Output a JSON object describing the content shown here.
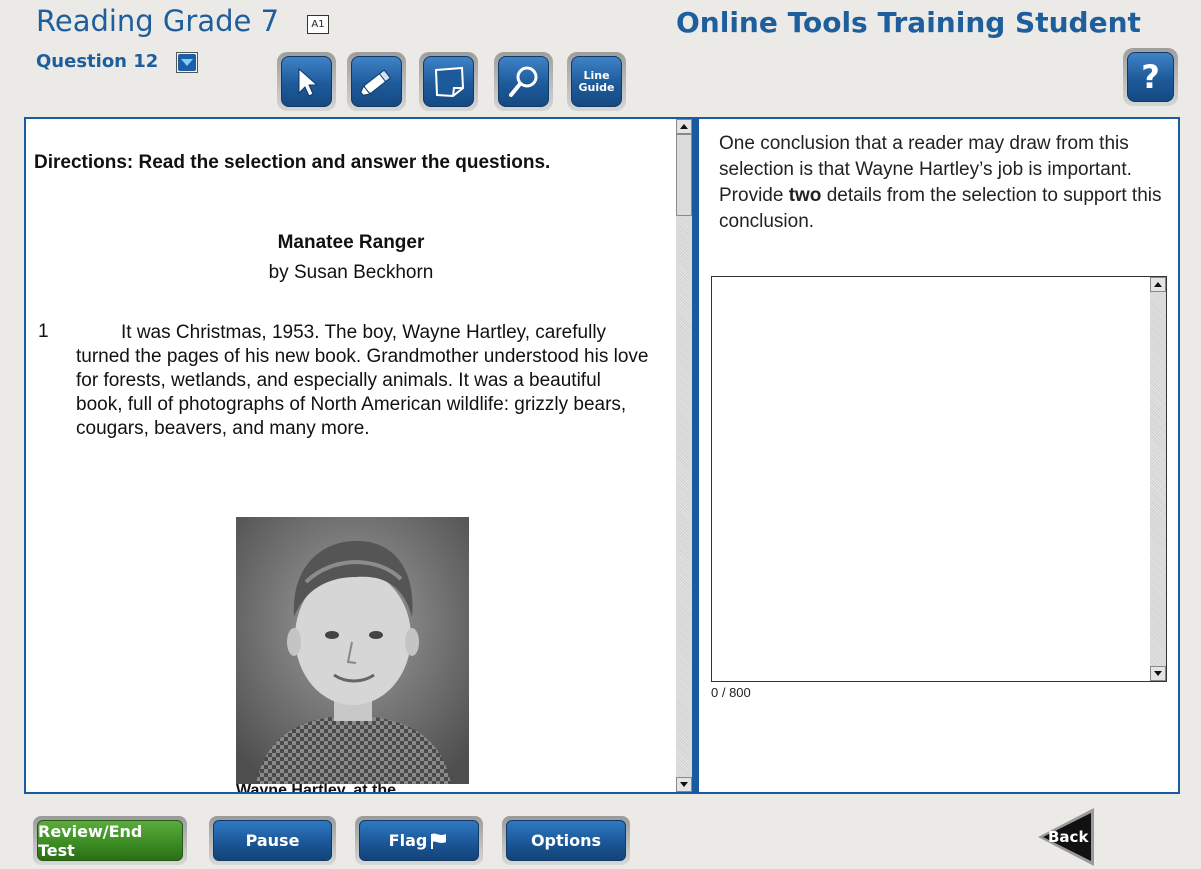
{
  "header": {
    "test_title": "Reading Grade 7",
    "accommodation_badge": "A1",
    "question_label": "Question 12",
    "student_name": "Online Tools Training Student"
  },
  "toolbar": {
    "tools": [
      {
        "name": "pointer",
        "icon": "pointer-arrow-icon"
      },
      {
        "name": "highlighter",
        "icon": "highlighter-icon"
      },
      {
        "name": "sticky-note",
        "icon": "sticky-note-icon"
      },
      {
        "name": "magnifier",
        "icon": "magnifier-icon"
      },
      {
        "name": "line-guide",
        "label_line1": "Line",
        "label_line2": "Guide"
      }
    ],
    "help_label": "?"
  },
  "passage": {
    "directions": "Directions: Read the selection and answer the questions.",
    "title": "Manatee Ranger",
    "author": "by Susan Beckhorn",
    "paragraph_number": "1",
    "paragraph_text": "It was Christmas, 1953. The boy, Wayne Hartley, carefully turned the pages of his new book. Grandmother understood his love for forests, wetlands, and especially animals. It was a beautiful book, full of photographs of North American wildlife: grizzly bears, cougars, beavers, and many more.",
    "photo_caption": "Wayne Hartley, at the"
  },
  "question": {
    "prompt_before": "One conclusion that a reader may draw from this selection is that Wayne Hartley’s job is important. Provide ",
    "prompt_bold": "two",
    "prompt_after": " details from the selection to support this conclusion.",
    "response_value": "",
    "char_count": "0 / 800"
  },
  "footer": {
    "review_label": "Review/End Test",
    "pause_label": "Pause",
    "flag_label": "Flag",
    "options_label": "Options",
    "back_label": "Back"
  },
  "colors": {
    "brand_blue": "#1f5e9c",
    "panel_border": "#1a5aa0",
    "review_green": "#3a8a22"
  }
}
